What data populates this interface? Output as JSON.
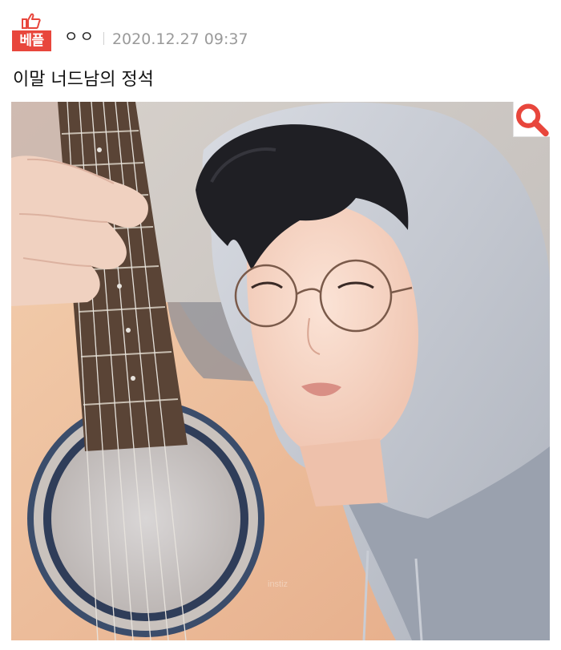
{
  "badge": {
    "label": "베플",
    "icon": "thumbs-up-icon",
    "color": "#e8463c"
  },
  "post": {
    "author": "ㅇㅇ",
    "timestamp": "2020.12.27 09:37",
    "title": "이말 너드남의 정석"
  },
  "photo": {
    "zoom_icon": "search-icon",
    "zoom_icon_color": "#e8463c"
  }
}
